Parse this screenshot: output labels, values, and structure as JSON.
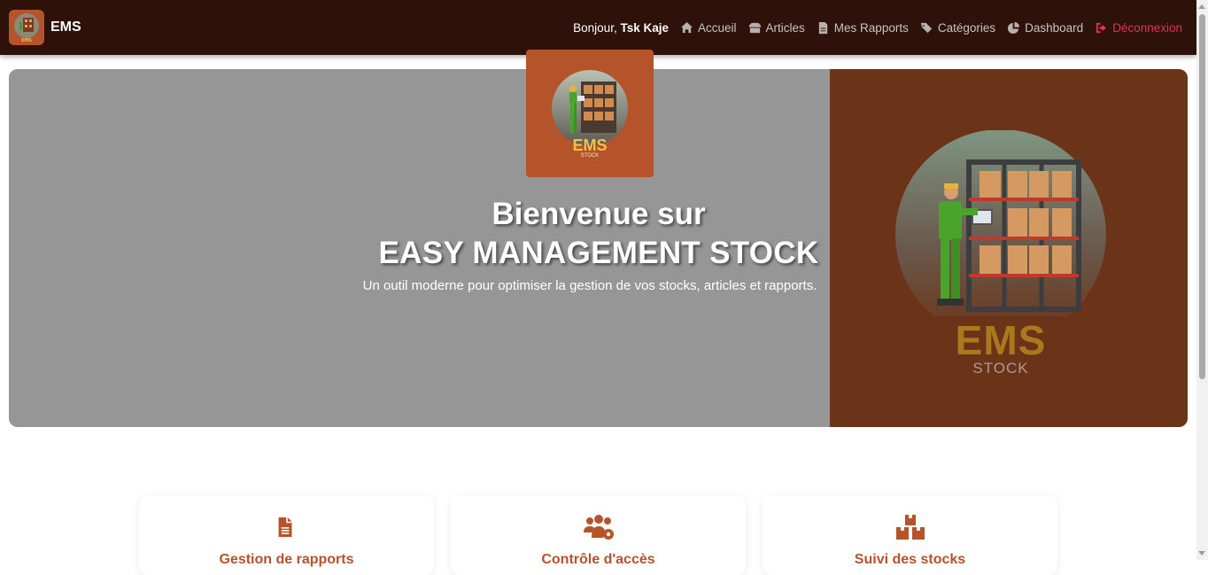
{
  "navbar": {
    "brand": "EMS",
    "greeting_prefix": "Bonjour,",
    "user_name": "Tsk Kaje",
    "items": [
      {
        "label": "Accueil",
        "icon": "home-icon"
      },
      {
        "label": "Articles",
        "icon": "box-icon"
      },
      {
        "label": "Mes Rapports",
        "icon": "file-icon"
      },
      {
        "label": "Catégories",
        "icon": "tags-icon"
      },
      {
        "label": "Dashboard",
        "icon": "chart-pie-icon"
      }
    ],
    "logout_label": "Déconnexion"
  },
  "hero": {
    "logo_text": "EMS",
    "logo_subtext": "STOCK",
    "title_line1": "Bienvenue sur",
    "title_line2": "EASY MANAGEMENT STOCK",
    "subtitle": "Un outil moderne pour optimiser la gestion de vos stocks, articles et rapports.",
    "side_logo_text": "EMS",
    "side_logo_subtext": "STOCK"
  },
  "features": [
    {
      "title": "Gestion de rapports",
      "icon": "file-lines-icon"
    },
    {
      "title": "Contrôle d'accès",
      "icon": "users-gear-icon"
    },
    {
      "title": "Suivi des stocks",
      "icon": "boxes-icon"
    }
  ],
  "colors": {
    "navbar_bg": "#2e120a",
    "accent": "#b5532a",
    "hero_gray": "#969696",
    "hero_brown": "#6b3418",
    "logout": "#e0334f"
  }
}
